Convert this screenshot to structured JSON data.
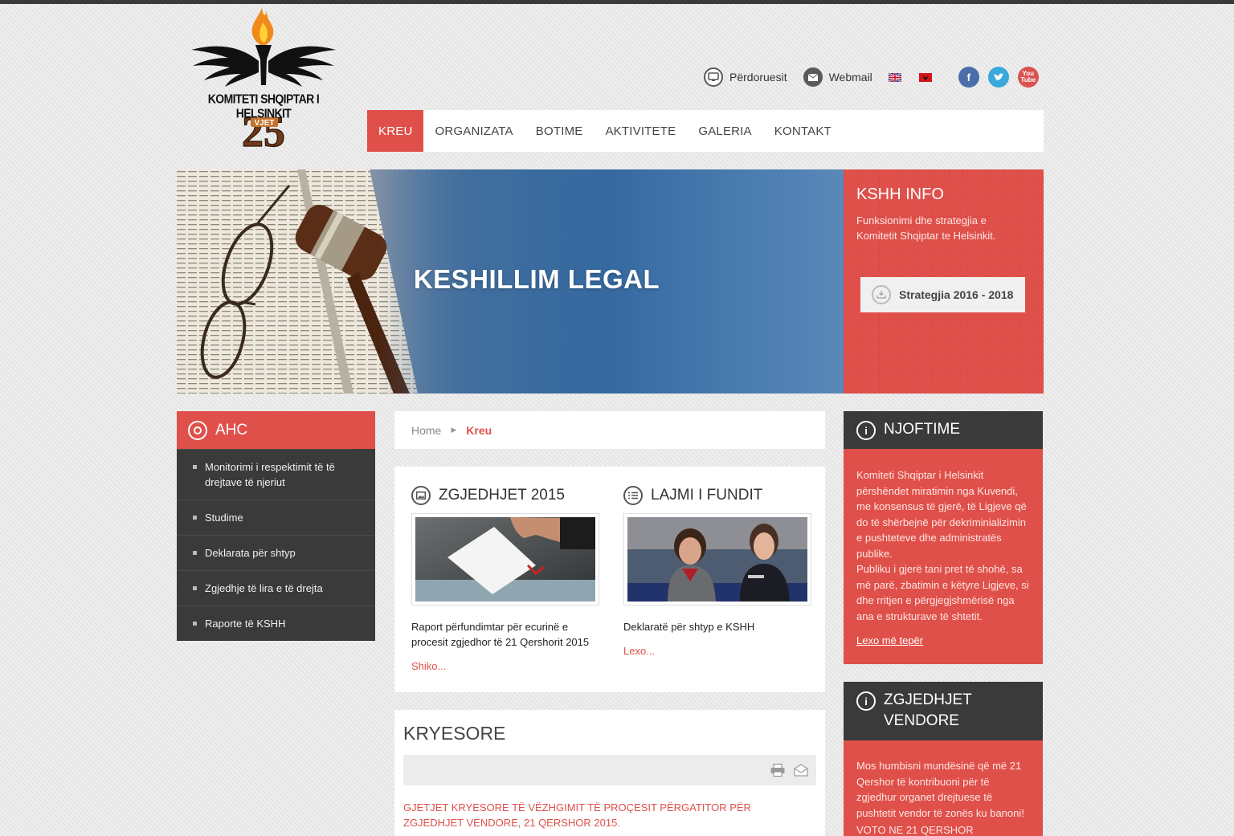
{
  "logo": {
    "org_name": "KOMITETI SHQIPTAR I HELSINKIT",
    "anniversary_number": "25",
    "anniversary_word": "VJET"
  },
  "top_links": {
    "users": "Përdoruesit",
    "webmail": "Webmail",
    "flags": [
      "flag-uk-icon",
      "flag-albania-icon"
    ],
    "social": [
      "facebook-icon",
      "twitter-icon",
      "youtube-icon"
    ]
  },
  "nav": {
    "items": [
      "KREU",
      "ORGANIZATA",
      "BOTIME",
      "AKTIVITETE",
      "GALERIA",
      "KONTAKT"
    ],
    "active": "KREU"
  },
  "hero": {
    "title": "KESHILLIM LEGAL"
  },
  "info": {
    "title": "KSHH INFO",
    "text": "Funksionimi dhe strategjia e Komitetit Shqiptar te Helsinkit.",
    "button": "Strategjia 2016 - 2018"
  },
  "ahc": {
    "title": "AHC",
    "items": [
      "Monitorimi i respektimit të të drejtave të njeriut",
      "Studime",
      "Deklarata për shtyp",
      "Zgjedhje të lira e të drejta",
      "Raporte të KSHH"
    ]
  },
  "breadcrumb": {
    "home": "Home",
    "current": "Kreu"
  },
  "news": {
    "left": {
      "title": "ZGJEDHJET 2015",
      "desc": "Raport përfundimtar për ecurinë e procesit zgjedhor të 21 Qershorit 2015",
      "more": "Shiko..."
    },
    "right": {
      "title": "LAJMI I FUNDIT",
      "desc": "Deklaratë për shtyp e KSHH",
      "more": "Lexo..."
    }
  },
  "kryesore": {
    "title": "KRYESORE",
    "text": "GJETJET KRYESORE TË VËZHGIMIT TË PROÇESIT PËRGATITOR PËR ZGJEDHJET VENDORE, 21 QERSHOR 2015."
  },
  "njoftime": {
    "title": "NJOFTIME",
    "p1": "Komiteti Shqiptar i Helsinkit përshëndet miratimin nga Kuvendi, me konsensus të gjerë, të Ligjeve që do të shërbejnë për dekriminializimin e pushteteve dhe administratës publike.",
    "p2": "Publiku i gjerë tani pret të shohë, sa më parë, zbatimin e këtyre Ligjeve, si dhe rritjen e përgjegjshmërisë nga ana e strukturave të shtetit.",
    "link": "Lexo më tepër"
  },
  "zgjedhjet_vendore": {
    "title_line1": "ZGJEDHJET",
    "title_line2": "VENDORE",
    "text": "Mos humbisni mundësinë që më 21 Qershor të kontribuoni për të zgjedhur organet drejtuese të pushtetit vendor të zonës ku banoni!",
    "cut_text": "VOTO NE 21 QERSHOR"
  },
  "colors": {
    "accent_red": "#e0504a",
    "dark_panel": "#3a3a3a"
  }
}
